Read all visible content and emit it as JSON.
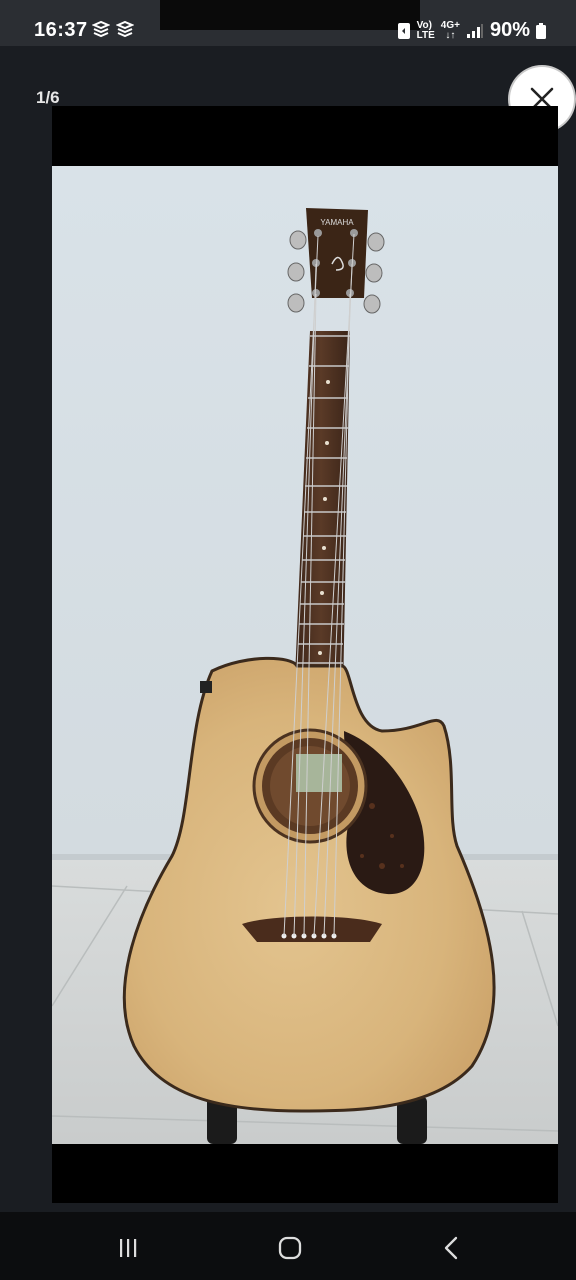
{
  "status_bar": {
    "time": "16:37",
    "network_top": "Vo)",
    "network_bottom": "LTE",
    "signal_top": "4G+",
    "battery": "90%"
  },
  "viewer": {
    "counter": "1/6",
    "close_icon": "close-icon"
  },
  "photo": {
    "subject": "guitar-photo",
    "headstock_text": "YAMAHA"
  },
  "nav": {
    "recents_icon": "recents-icon",
    "home_icon": "home-icon",
    "back_icon": "back-icon"
  }
}
